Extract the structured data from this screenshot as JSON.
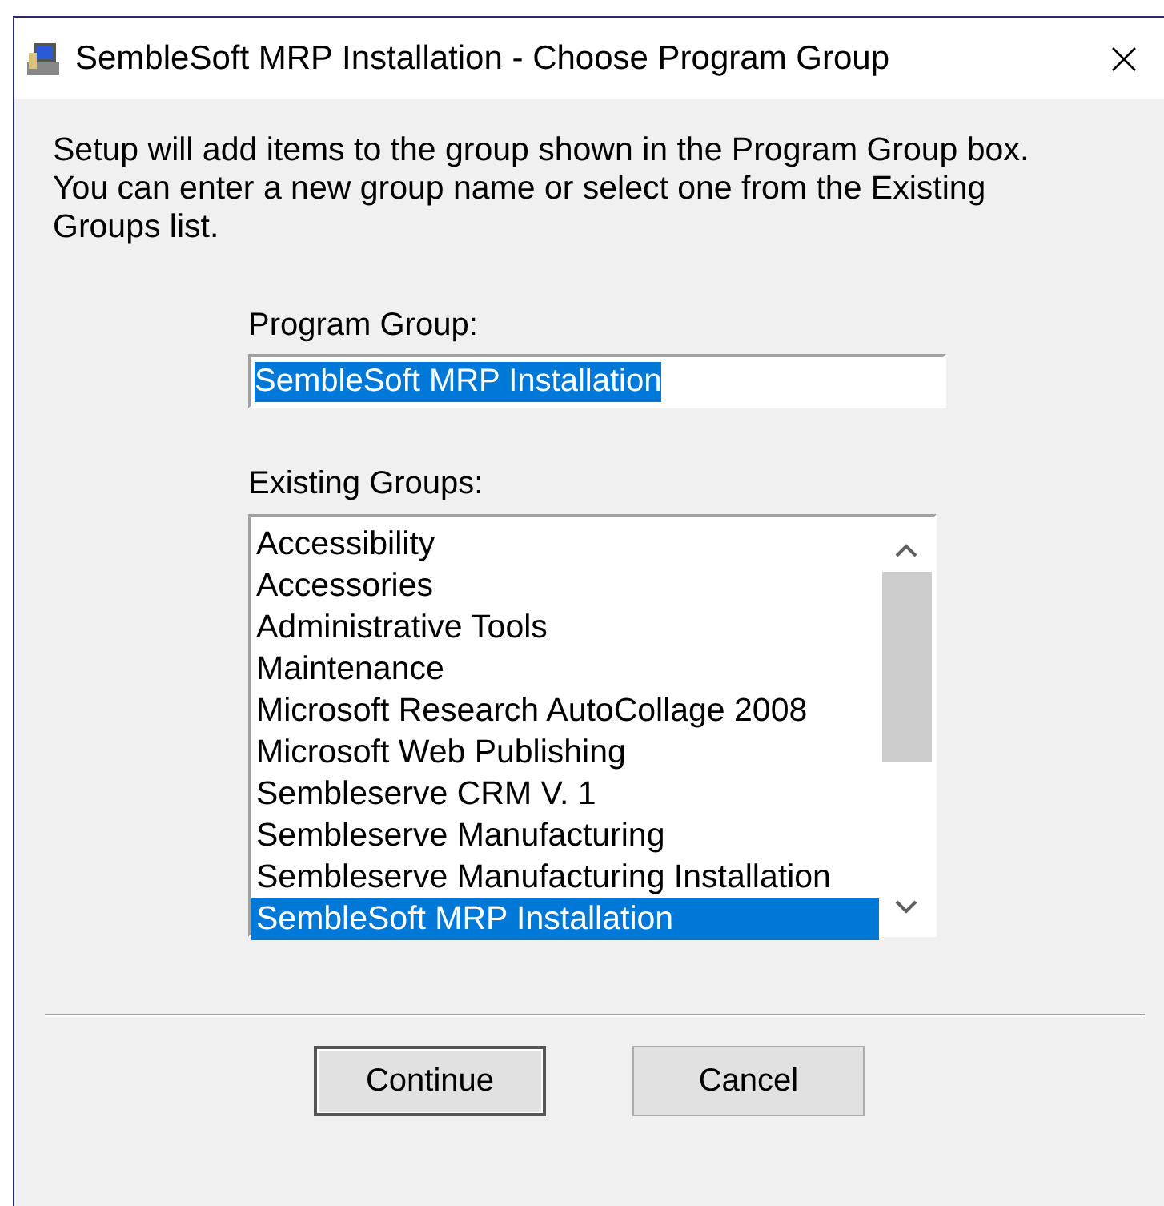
{
  "window": {
    "title": "SembleSoft MRP Installation - Choose Program Group"
  },
  "intro": "Setup will add items to the group shown in the Program Group box. You can enter a new group name or select one from the Existing Groups list.",
  "program_group": {
    "label": "Program Group:",
    "value": "SembleSoft MRP Installation",
    "text_selected": true
  },
  "existing_groups": {
    "label": "Existing Groups:",
    "items": [
      {
        "label": "Accessibility",
        "selected": false
      },
      {
        "label": "Accessories",
        "selected": false
      },
      {
        "label": "Administrative Tools",
        "selected": false
      },
      {
        "label": "Maintenance",
        "selected": false
      },
      {
        "label": "Microsoft Research AutoCollage 2008",
        "selected": false
      },
      {
        "label": "Microsoft Web Publishing",
        "selected": false
      },
      {
        "label": "Sembleserve CRM V. 1",
        "selected": false
      },
      {
        "label": "Sembleserve Manufacturing",
        "selected": false
      },
      {
        "label": "Sembleserve Manufacturing Installation",
        "selected": false
      },
      {
        "label": "SembleSoft MRP Installation",
        "selected": true
      }
    ]
  },
  "buttons": [
    {
      "label": "Continue",
      "default": true
    },
    {
      "label": "Cancel",
      "default": false
    }
  ]
}
